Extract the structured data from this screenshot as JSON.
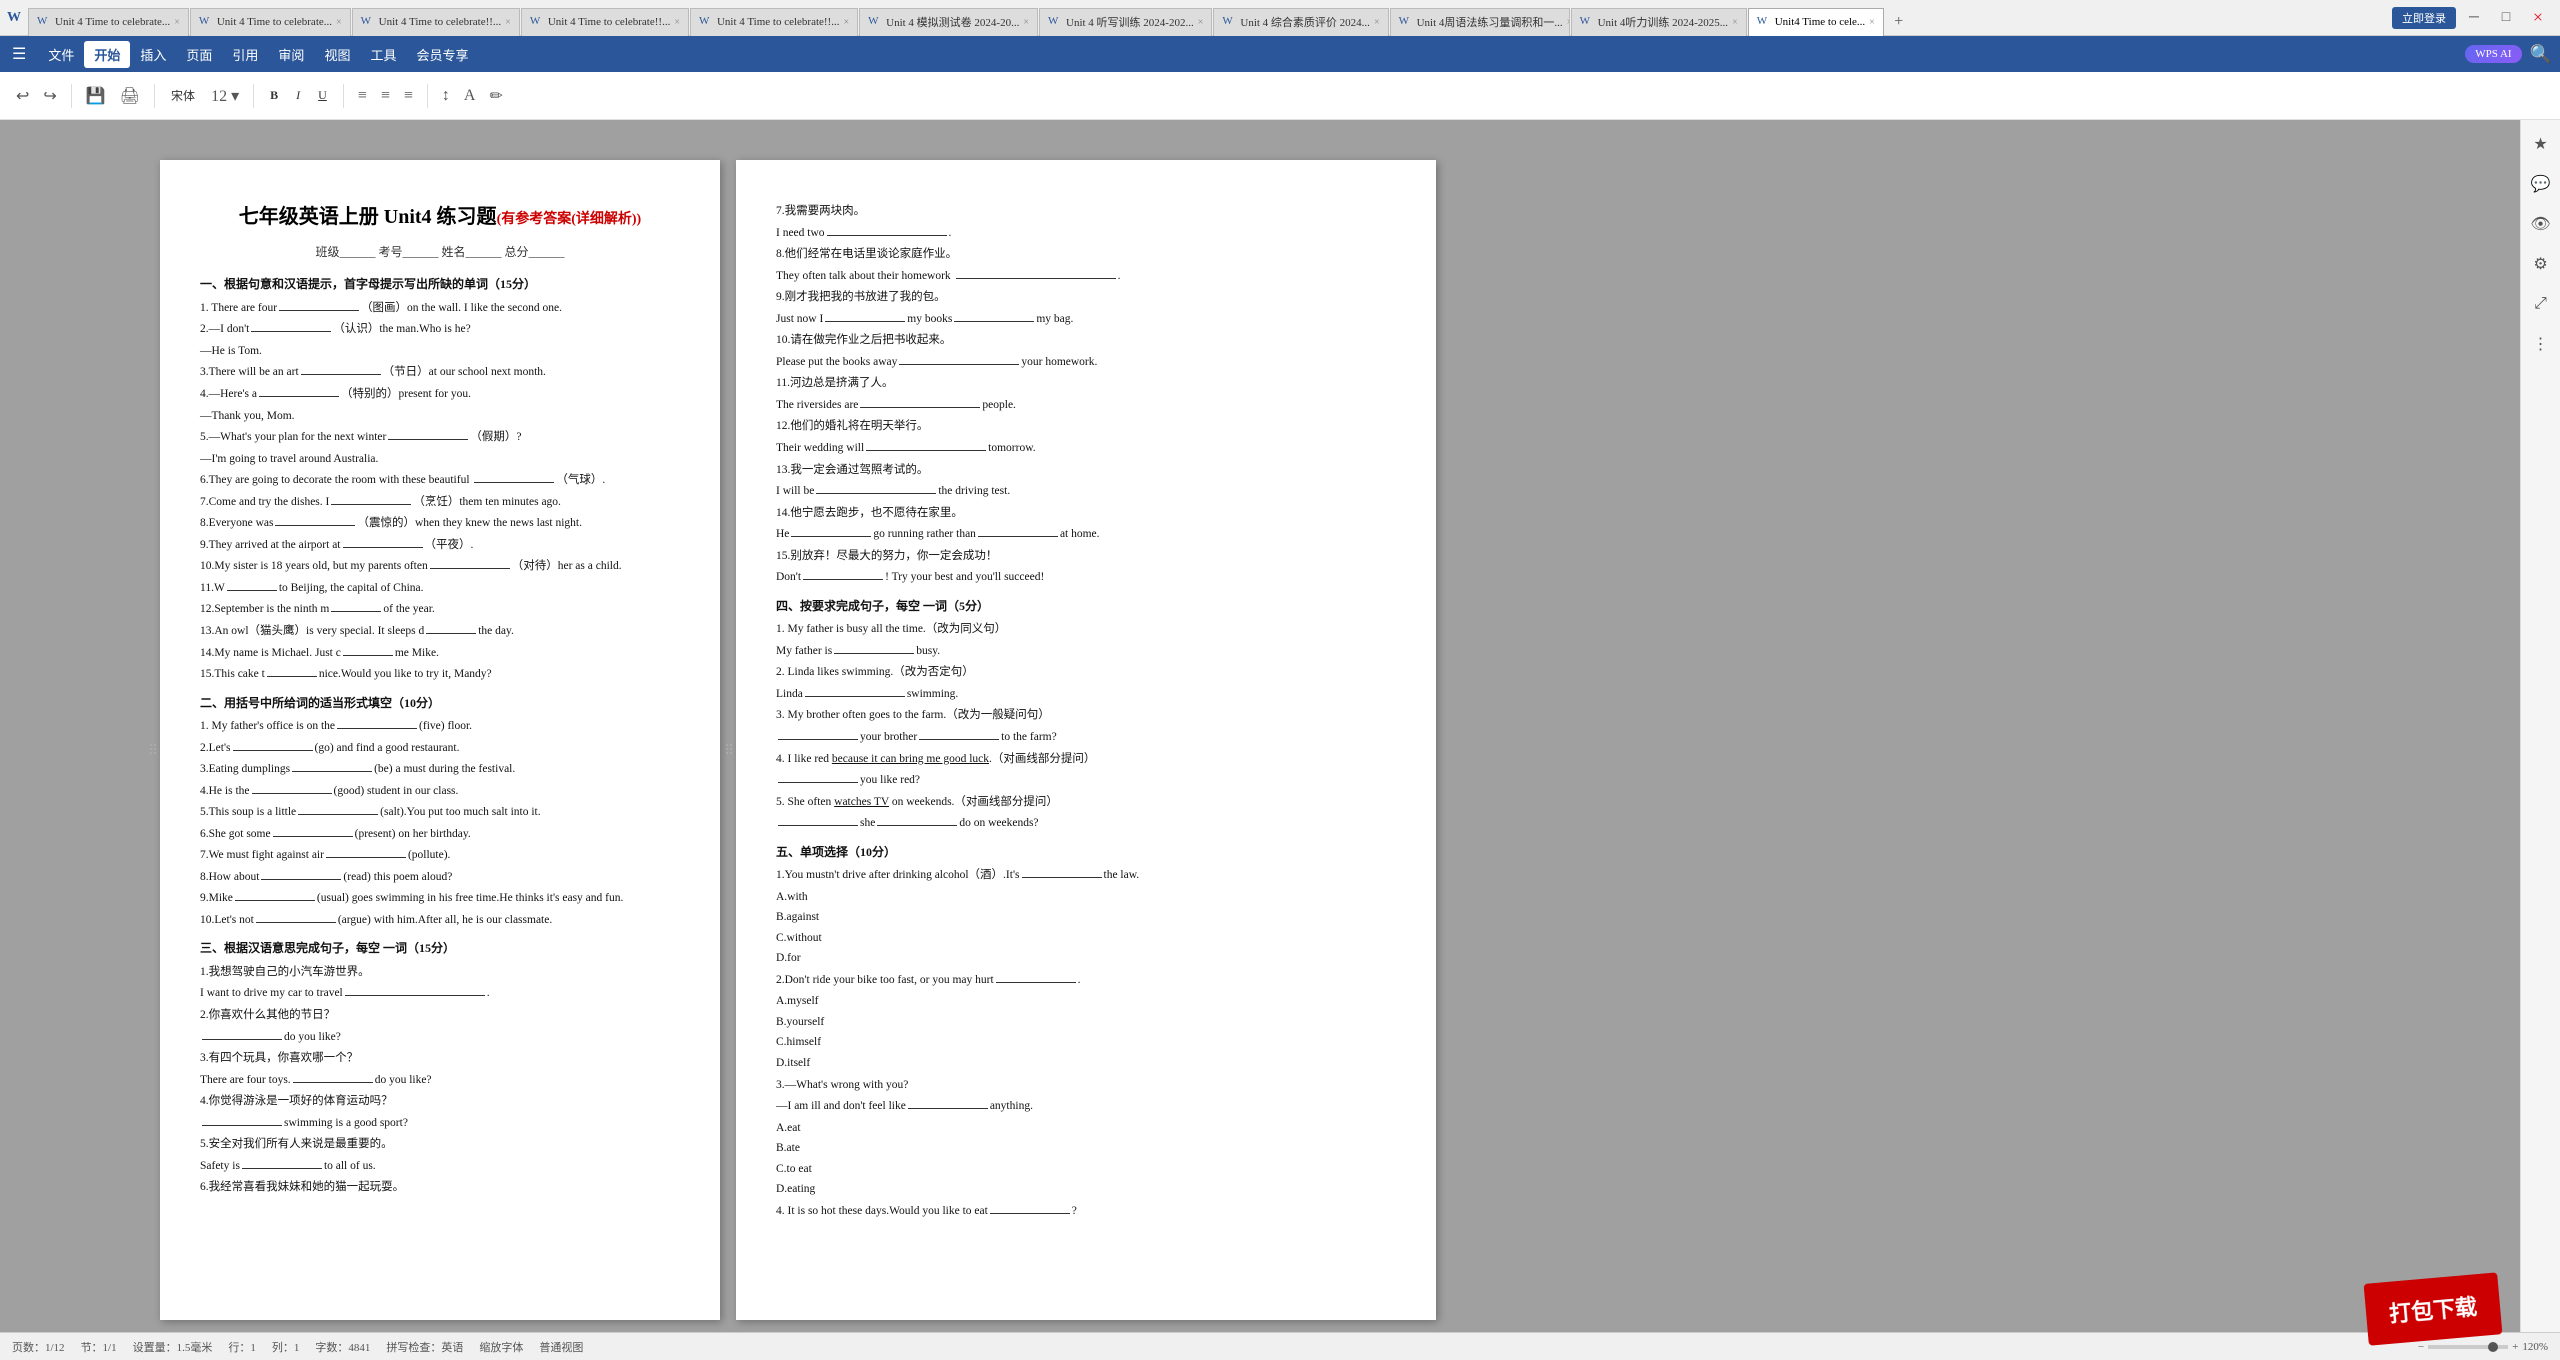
{
  "tabs": [
    {
      "label": "Unit 4 Time to celebrate...",
      "active": false,
      "id": 1
    },
    {
      "label": "Unit 4 Time to celebrate...",
      "active": false,
      "id": 2
    },
    {
      "label": "Unit 4 Time to celebrate!!...",
      "active": false,
      "id": 3
    },
    {
      "label": "Unit 4 Time to celebrate!!...",
      "active": false,
      "id": 4
    },
    {
      "label": "Unit 4 Time to celebrate!!...",
      "active": false,
      "id": 5
    },
    {
      "label": "Unit 4 模拟测试卷 2024-20...",
      "active": false,
      "id": 6
    },
    {
      "label": "Unit 4 听写训练 2024-202...",
      "active": false,
      "id": 7
    },
    {
      "label": "Unit 4 综合素质评价 2024...",
      "active": false,
      "id": 8
    },
    {
      "label": "Unit 4周语法练习量调积和一...",
      "active": false,
      "id": 9
    },
    {
      "label": "Unit 4听力训练 2024-2025...",
      "active": false,
      "id": 10
    },
    {
      "label": "Unit4 Time to cele...",
      "active": true,
      "id": 11
    }
  ],
  "menu": {
    "items": [
      "文件",
      "开始",
      "插入",
      "页面",
      "引用",
      "审阅",
      "视图",
      "工具",
      "会员专享"
    ],
    "active_item": "开始",
    "wps_ai": "WPS AI"
  },
  "document": {
    "title": "七年级英语上册 Unit4 练习题",
    "subtitle_red": "(有参考答案(详细解析))",
    "info_line": "班级______  考号______  姓名______  总分______",
    "sections": [
      {
        "title": "一、根据句意和汉语提示，首字母提示写出所缺的单词（15分）",
        "items": [
          "1. There are four______（图画）on the wall. I like the second one.",
          "2.—I don't______（认识）the man.Who is he?",
          "—He is Tom.",
          "3.There will be an art______（节日）at our school next month.",
          "4.—Here's a______（特别的）present for you.",
          "—Thank you, Mom.",
          "5.—What's your plan for the next winter______（假期）?",
          "—I'm going to travel around Australia.",
          "6.They are going to decorate the room with these beautiful ______（气球）.",
          "7.Come and try the dishes. I______（烹饪）them ten minutes ago.",
          "8.Everyone was______（震惊的）when they knew the news last night.",
          "9.They arrived at the airport at______（平夜）.",
          "10.My sister is 18 years old, but my parents often______（对待）her as a child.",
          "11.W______to Beijing, the capital of China.",
          "12.September is the ninth m______of the year.",
          "13.An owl（猫头鹰）is very special. It sleeps d______the day.",
          "14.My name is Michael. Just c______me Mike.",
          "15.This cake t______nice.Would you like to try it, Mandy?"
        ]
      },
      {
        "title": "二、用括号中所给词的适当形式填空（10分）",
        "items": [
          "1. My father's office is on the______(five) floor.",
          "2.Let's______(go) and find a good restaurant.",
          "3.Eating dumplings______(be) a must during the festival.",
          "4.He is the______(good) student in our class.",
          "5.This soup is a little______(salt).You put too much salt into it.",
          "6.She got some______(present) on her birthday.",
          "7.We must fight against air______(pollute).",
          "8.How about______(read) this poem aloud?",
          "9.Mike______(usual) goes swimming in his free time.He thinks it's easy and fun.",
          "10.Let's not______(argue) with him.After all, he is our classmate."
        ]
      },
      {
        "title": "三、根据汉语意思完成句子，每空 一词（15分）",
        "items": [
          "1.我想驾驶自己的小汽车游世界。",
          "I want to drive my car to travel______________________.",
          "2.你喜欢什么其他的节日？",
          "______do you like?",
          "3.有四个玩具，你喜欢哪一个？",
          "There are four toys.______do you like?",
          "4.你觉得游泳是一项好的体育运动吗？",
          "______swimming is a good sport?",
          "5.安全对我们所有人来说是最重要的。",
          "Safety is______to all of us.",
          "6.我经常喜看我妹妹和她的猫一起玩耍。"
        ]
      }
    ],
    "right_sections": [
      "7.我需要两块肉。",
      "I need two______.",
      "8.他们经常在电话里谈论家庭作业。",
      "They often talk about their homework ______.",
      "9.刚才我把我的书放进了我的包。",
      "Just now I______my books______my bag.",
      "10.请在做完作业之后把书收起来。",
      "Please put the books away______your homework.",
      "11.河边总是挤满了人。",
      "The riversides are______people.",
      "12.他们的婚礼将在明天举行。",
      "Their wedding will______tomorrow.",
      "13.我一定会通过驾照考试的。",
      "I will be______the driving test.",
      "14.他宁愿去跑步，也不愿待在家里。",
      "He______go running rather than______at home.",
      "15.别放弃！尽最大的努力，你一定会成功！",
      "Don't______! Try your best and you'll succeed!",
      "",
      "四、按要求完成句子，每空 一词（5分）",
      "1. My father is busy all the time.（改为同义句）",
      "My father is______busy.",
      "2. Linda likes swimming.（改为否定句）",
      "Linda____________________swimming.",
      "3. My brother often goes to the farm.（改为一般疑问句）",
      "______your brother______to the farm?",
      "4. I like red because it can bring me good luck.（对画线部分提问）",
      "______you like red?",
      "5. She often watches TV on weekends.（对画线部分提问）",
      "______she______do on weekends?",
      "",
      "五、单项选择（10分）",
      "1.You mustn't drive after drinking alcohol（酒）.It's______the law.",
      "A.with",
      "B.against",
      "C.without",
      "D.for",
      "2.Don't ride your bike too fast, or you may hurt______.",
      "A.myself",
      "B.yourself",
      "C.himself",
      "D.itself",
      "3.—What's wrong with you?",
      "—I am ill and don't feel like______anything.",
      "A.eat",
      "B.ate",
      "C.to eat",
      "D.eating",
      "4. It is so hot these days.Would you like to eat______?"
    ]
  },
  "status_bar": {
    "page_info": "页数：1/12",
    "section": "节：1/1",
    "line_spacing": "设置量：1.5毫米",
    "line": "行：1",
    "col": "列：1",
    "word_count": "字数：4841",
    "spell_check": "拼写检查：英语",
    "read_mode": "缩放字体",
    "layout_mode": "普通视图",
    "zoom": "120%"
  },
  "red_stamp": {
    "text": "打包下载"
  },
  "right_panel_icons": [
    "star",
    "comment",
    "eye",
    "settings",
    "expand",
    "dots"
  ],
  "signin_label": "立即登录"
}
